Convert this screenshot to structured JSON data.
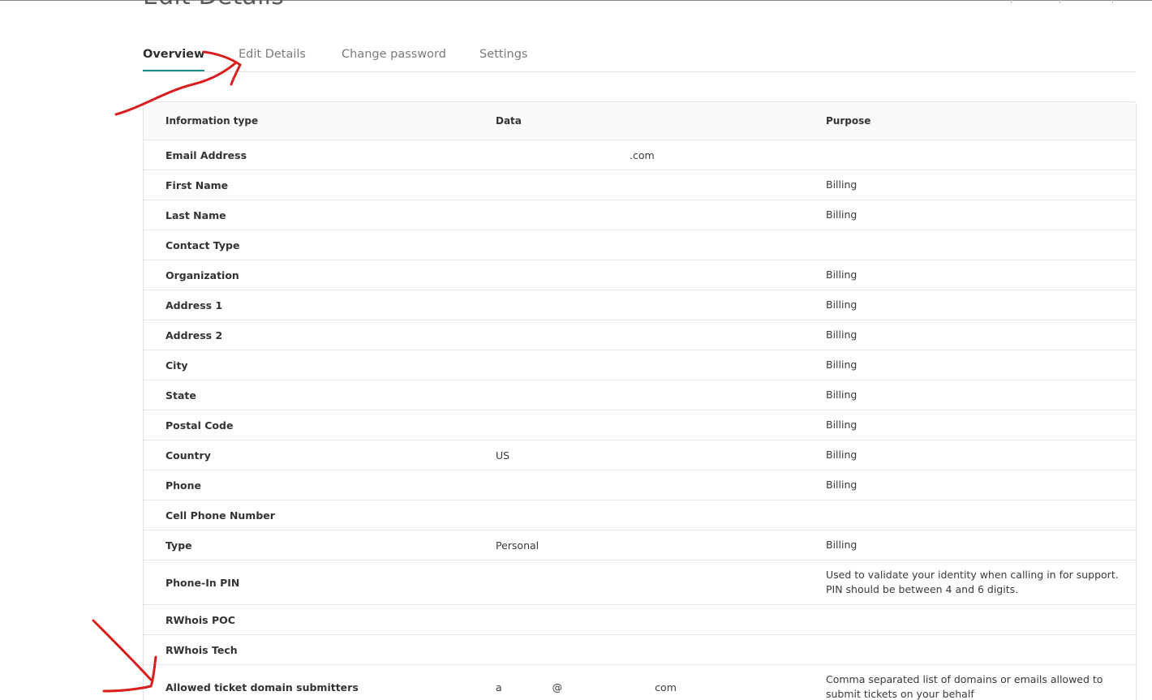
{
  "page": {
    "title": "Edit Details"
  },
  "tabs": [
    {
      "label": "Overview",
      "active": true
    },
    {
      "label": "Edit Details",
      "active": false
    },
    {
      "label": "Change password",
      "active": false
    },
    {
      "label": "Settings",
      "active": false
    }
  ],
  "table": {
    "headers": [
      "Information type",
      "Data",
      "Purpose"
    ],
    "rows": [
      {
        "type": "Email Address",
        "data": ".com",
        "purpose": ""
      },
      {
        "type": "First Name",
        "data": "",
        "purpose": "Billing"
      },
      {
        "type": "Last Name",
        "data": "",
        "purpose": "Billing"
      },
      {
        "type": "Contact Type",
        "data": "",
        "purpose": ""
      },
      {
        "type": "Organization",
        "data": "",
        "purpose": "Billing"
      },
      {
        "type": "Address 1",
        "data": "",
        "purpose": "Billing"
      },
      {
        "type": "Address 2",
        "data": "",
        "purpose": "Billing"
      },
      {
        "type": "City",
        "data": "",
        "purpose": "Billing"
      },
      {
        "type": "State",
        "data": "",
        "purpose": "Billing"
      },
      {
        "type": "Postal Code",
        "data": "",
        "purpose": "Billing"
      },
      {
        "type": "Country",
        "data": "US",
        "purpose": "Billing"
      },
      {
        "type": "Phone",
        "data": "",
        "purpose": "Billing"
      },
      {
        "type": "Cell Phone Number",
        "data": "",
        "purpose": ""
      },
      {
        "type": "Type",
        "data": "Personal",
        "purpose": "Billing"
      },
      {
        "type": "Phone-In PIN",
        "data": "",
        "purpose_lines": [
          "Used to validate your identity when calling in for support.",
          "PIN should be between 4 and 6 digits."
        ]
      },
      {
        "type": "RWhois POC",
        "data": "",
        "purpose": ""
      },
      {
        "type": "RWhois Tech",
        "data": "",
        "purpose": ""
      },
      {
        "type": "Allowed ticket domain submitters",
        "data_parts": [
          "a",
          "@",
          "com"
        ],
        "purpose_lines": [
          "Comma separated list of domains or emails allowed to",
          "submit tickets on your behalf"
        ]
      }
    ]
  },
  "colors": {
    "accent": "#1f8f8a",
    "annotation": "#d81e1e"
  }
}
